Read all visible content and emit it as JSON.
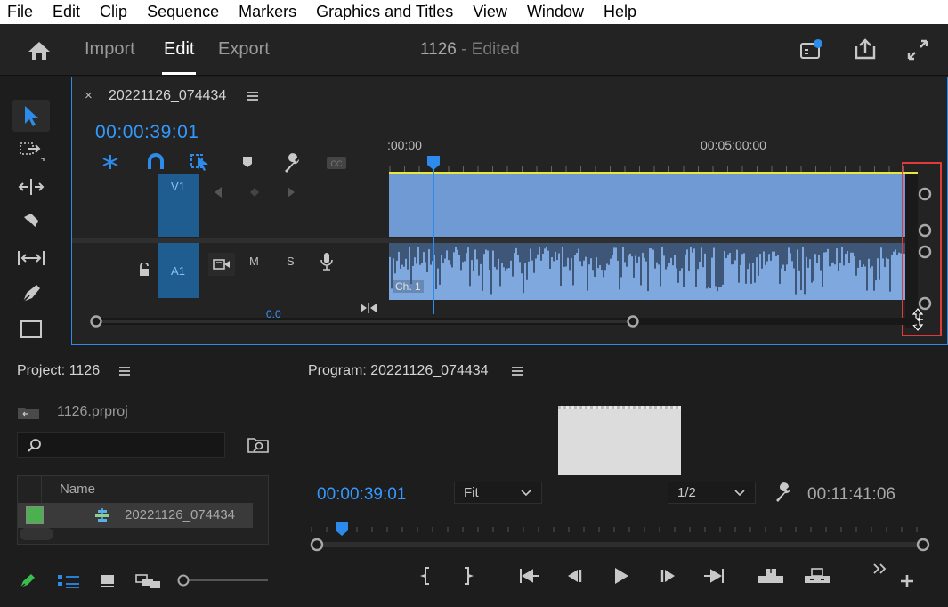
{
  "menu": [
    "File",
    "Edit",
    "Clip",
    "Sequence",
    "Markers",
    "Graphics and Titles",
    "View",
    "Window",
    "Help"
  ],
  "header": {
    "tabs": [
      "Import",
      "Edit",
      "Export"
    ],
    "active_tab": "Edit",
    "project_name": "1126",
    "project_status": "- Edited"
  },
  "timeline": {
    "sequence_name": "20221126_074434",
    "close_glyph": "×",
    "timecode": "00:00:39:01",
    "ruler_labels": [
      ":00:00",
      "00:05:00:00"
    ],
    "tracks": {
      "v1": "V1",
      "a1": "A1",
      "mute": "M",
      "solo": "S",
      "channel": "Ch. 1"
    },
    "zero_readout": "0.0"
  },
  "project": {
    "title": "Project: 1126",
    "file": "1126.prproj",
    "search_placeholder": "",
    "column_name": "Name",
    "items": [
      {
        "name": "20221126_074434",
        "label_color": "#4caf50"
      }
    ]
  },
  "program": {
    "title": "Program: 20221126_074434",
    "timecode": "00:00:39:01",
    "fit": "Fit",
    "resolution": "1/2",
    "duration": "00:11:41:06"
  },
  "colors": {
    "accent": "#2d8ceb",
    "timecode": "#3399ff",
    "clip": "#6f9ad4",
    "track_target": "#1f5c8f",
    "highlight_box": "#e03a3a",
    "work_area": "#e8e83a"
  }
}
